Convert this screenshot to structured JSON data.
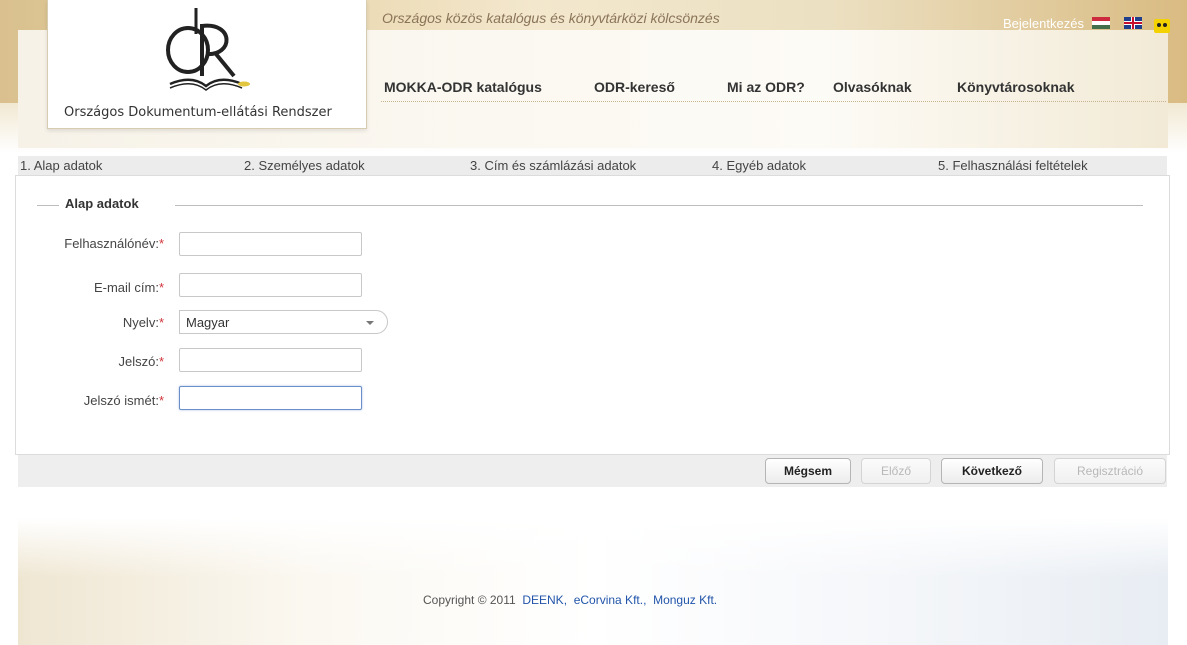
{
  "header": {
    "tagline": "Országos közös katalógus és könyvtárközi kölcsönzés",
    "login_label": "Bejelentkezés",
    "logo_text": "Országos Dokumentum-ellátási Rendszer",
    "languages": [
      "hu-flag-icon",
      "uk-flag-icon"
    ],
    "accessibility_icon": "accessibility-icon"
  },
  "nav": {
    "items": [
      {
        "label": "MOKKA-ODR katalógus"
      },
      {
        "label": "ODR-kereső"
      },
      {
        "label": "Mi az ODR?"
      },
      {
        "label": "Olvasóknak"
      },
      {
        "label": "Könyvtárosoknak"
      }
    ]
  },
  "steps": [
    {
      "label": "1. Alap adatok"
    },
    {
      "label": "2. Személyes adatok"
    },
    {
      "label": "3. Cím és számlázási adatok"
    },
    {
      "label": "4. Egyéb adatok"
    },
    {
      "label": "5. Felhasználási feltételek"
    }
  ],
  "form": {
    "legend": "Alap adatok",
    "required_marker": "*",
    "fields": [
      {
        "label": "Felhasználónév:",
        "value": ""
      },
      {
        "label": "E-mail cím:",
        "value": ""
      },
      {
        "label": "Nyelv:",
        "value": "Magyar"
      },
      {
        "label": "Jelszó:",
        "value": ""
      },
      {
        "label": "Jelszó ismét:",
        "value": ""
      }
    ]
  },
  "buttons": {
    "cancel": "Mégsem",
    "previous": "Előző",
    "next": "Következő",
    "register": "Regisztráció"
  },
  "footer": {
    "copyright": "Copyright © 2011",
    "links": [
      "DEENK,",
      "eCorvina Kft.,",
      "Monguz Kft."
    ]
  },
  "colors": {
    "banner": "#e8d3a6",
    "required": "#d0343a",
    "link": "#2255aa"
  }
}
